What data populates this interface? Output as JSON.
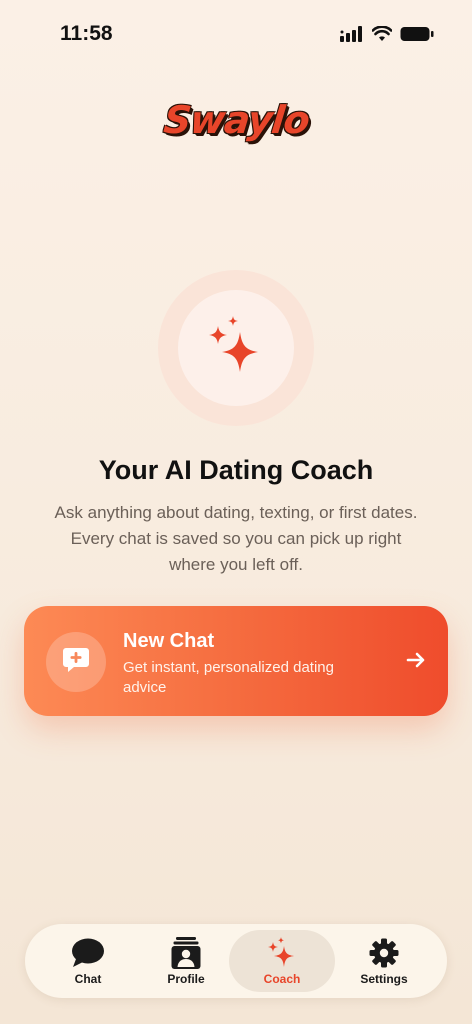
{
  "status": {
    "time": "11:58",
    "icons": [
      "signal-icon",
      "wifi-icon",
      "battery-icon"
    ]
  },
  "logo": {
    "text": "Swaylo"
  },
  "hero": {
    "icon": "sparkles-icon",
    "title": "Your AI Dating Coach",
    "subtitle": "Ask anything about dating, texting, or first dates. Every chat is saved so you can pick up right where you left off."
  },
  "new_chat": {
    "title": "New Chat",
    "description": "Get instant, personalized dating advice",
    "icon": "chat-plus-icon",
    "arrow_icon": "arrow-right-icon"
  },
  "tabbar": {
    "tabs": [
      {
        "label": "Chat",
        "icon": "chat-bubble-icon",
        "active": false
      },
      {
        "label": "Profile",
        "icon": "profile-icon",
        "active": false
      },
      {
        "label": "Coach",
        "icon": "sparkles-icon",
        "active": true
      },
      {
        "label": "Settings",
        "icon": "gear-icon",
        "active": false
      }
    ]
  },
  "colors": {
    "accent": "#e8452a",
    "card_start": "#fd8a55",
    "card_end": "#ef4c2c",
    "background": "#fbf0e6"
  }
}
